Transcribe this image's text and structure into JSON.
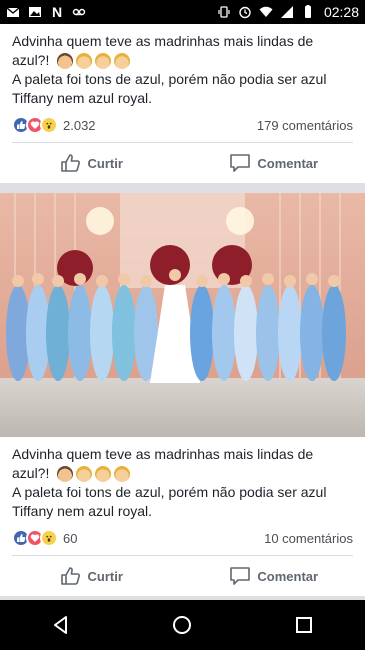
{
  "status_bar": {
    "time": "02:28",
    "left_icons": [
      "gmail-icon",
      "gallery-icon",
      "netflix-icon",
      "voicemail-icon"
    ],
    "right_icons": [
      "vibrate-icon",
      "alarm-icon",
      "wifi-icon",
      "signal-icon",
      "battery-icon"
    ],
    "netflix_letter": "N"
  },
  "posts": [
    {
      "text_line1": "Advinha quem teve as madrinhas mais lindas de azul?!",
      "text_line2": "A paleta foi tons de azul, porém não podia ser azul Tiffany nem azul royal.",
      "reaction_count": "2.032",
      "comments": "179 comentários",
      "like_label": "Curtir",
      "comment_label": "Comentar",
      "reactions": [
        "like",
        "love",
        "wow"
      ]
    },
    {
      "text_line1": "Advinha quem teve as madrinhas mais lindas de azul?!",
      "text_line2": "A paleta foi tons de azul, porém não podia ser azul Tiffany nem azul royal.",
      "reaction_count": "60",
      "comments": "10 comentários",
      "like_label": "Curtir",
      "comment_label": "Comentar",
      "reactions": [
        "like",
        "love",
        "wow"
      ]
    }
  ],
  "colors": {
    "like_blue": "#4267b2",
    "love_red": "#f25268",
    "wow_yellow": "#f7d14b",
    "text": "#1d2129",
    "secondary_text": "#606770"
  },
  "nav_bar": {
    "buttons": [
      "back-icon",
      "home-icon",
      "recents-icon"
    ]
  }
}
